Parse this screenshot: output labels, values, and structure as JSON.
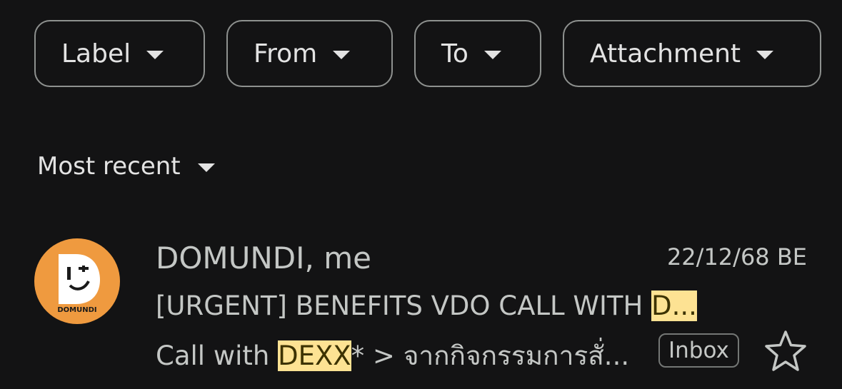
{
  "filters": {
    "label": "Label",
    "from": "From",
    "to": "To",
    "attachment": "Attachment"
  },
  "sort": {
    "label": "Most recent"
  },
  "email": {
    "sender": "DOMUNDI, me",
    "date": "22/12/68 BE",
    "subject_prefix": "[URGENT] BENEFITS VDO CALL WITH ",
    "subject_highlight": "D...",
    "snippet_prefix": "Call with ",
    "snippet_highlight": "DEXX",
    "snippet_suffix": "* > จากกิจกรรมการสั่...",
    "badge": "Inbox",
    "avatar_logo_text": "DOMUNDI",
    "avatar_color": "#ef9a3f"
  },
  "colors": {
    "background": "#131314",
    "highlight": "#fde293"
  },
  "icons": {
    "filter_caret": "caret-down-icon",
    "star": "star-outline-icon"
  }
}
